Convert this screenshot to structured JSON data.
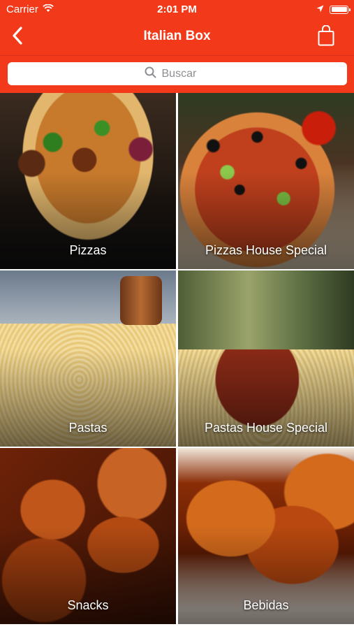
{
  "status_bar": {
    "carrier": "Carrier",
    "time": "2:01 PM",
    "battery_level": 1.0
  },
  "nav": {
    "title": "Italian Box",
    "back_icon": "chevron-left-icon",
    "bag_icon": "shopping-bag-icon"
  },
  "search": {
    "placeholder": "Buscar"
  },
  "categories": [
    {
      "label": "Pizzas"
    },
    {
      "label": "Pizzas House Special"
    },
    {
      "label": "Pastas"
    },
    {
      "label": "Pastas House Special"
    },
    {
      "label": "Snacks"
    },
    {
      "label": "Bebidas"
    }
  ],
  "colors": {
    "accent": "#f23a1a"
  }
}
